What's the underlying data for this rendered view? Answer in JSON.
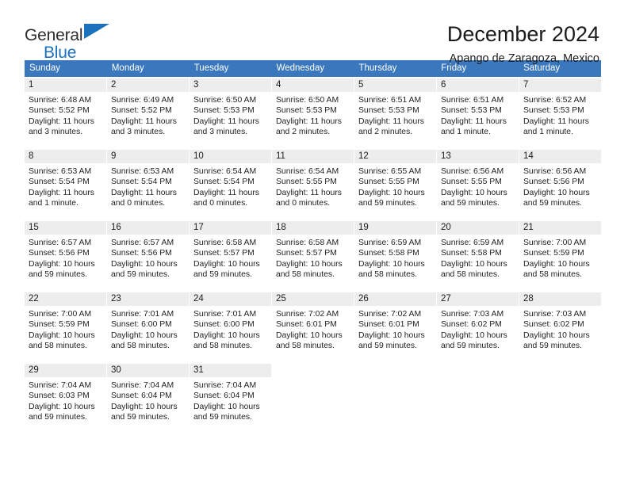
{
  "logo": {
    "line1": "General",
    "line2": "Blue"
  },
  "header": {
    "title": "December 2024",
    "subtitle": "Apango de Zaragoza, Mexico"
  },
  "colors": {
    "header_blue": "#3b77bc",
    "logo_blue": "#1a72bd",
    "daynum_bg": "#ededed",
    "text": "#232323"
  },
  "weekdays": [
    "Sunday",
    "Monday",
    "Tuesday",
    "Wednesday",
    "Thursday",
    "Friday",
    "Saturday"
  ],
  "weeks": [
    [
      {
        "day": "1",
        "sunrise": "Sunrise: 6:48 AM",
        "sunset": "Sunset: 5:52 PM",
        "daylight_1": "Daylight: 11 hours",
        "daylight_2": "and 3 minutes."
      },
      {
        "day": "2",
        "sunrise": "Sunrise: 6:49 AM",
        "sunset": "Sunset: 5:52 PM",
        "daylight_1": "Daylight: 11 hours",
        "daylight_2": "and 3 minutes."
      },
      {
        "day": "3",
        "sunrise": "Sunrise: 6:50 AM",
        "sunset": "Sunset: 5:53 PM",
        "daylight_1": "Daylight: 11 hours",
        "daylight_2": "and 3 minutes."
      },
      {
        "day": "4",
        "sunrise": "Sunrise: 6:50 AM",
        "sunset": "Sunset: 5:53 PM",
        "daylight_1": "Daylight: 11 hours",
        "daylight_2": "and 2 minutes."
      },
      {
        "day": "5",
        "sunrise": "Sunrise: 6:51 AM",
        "sunset": "Sunset: 5:53 PM",
        "daylight_1": "Daylight: 11 hours",
        "daylight_2": "and 2 minutes."
      },
      {
        "day": "6",
        "sunrise": "Sunrise: 6:51 AM",
        "sunset": "Sunset: 5:53 PM",
        "daylight_1": "Daylight: 11 hours",
        "daylight_2": "and 1 minute."
      },
      {
        "day": "7",
        "sunrise": "Sunrise: 6:52 AM",
        "sunset": "Sunset: 5:53 PM",
        "daylight_1": "Daylight: 11 hours",
        "daylight_2": "and 1 minute."
      }
    ],
    [
      {
        "day": "8",
        "sunrise": "Sunrise: 6:53 AM",
        "sunset": "Sunset: 5:54 PM",
        "daylight_1": "Daylight: 11 hours",
        "daylight_2": "and 1 minute."
      },
      {
        "day": "9",
        "sunrise": "Sunrise: 6:53 AM",
        "sunset": "Sunset: 5:54 PM",
        "daylight_1": "Daylight: 11 hours",
        "daylight_2": "and 0 minutes."
      },
      {
        "day": "10",
        "sunrise": "Sunrise: 6:54 AM",
        "sunset": "Sunset: 5:54 PM",
        "daylight_1": "Daylight: 11 hours",
        "daylight_2": "and 0 minutes."
      },
      {
        "day": "11",
        "sunrise": "Sunrise: 6:54 AM",
        "sunset": "Sunset: 5:55 PM",
        "daylight_1": "Daylight: 11 hours",
        "daylight_2": "and 0 minutes."
      },
      {
        "day": "12",
        "sunrise": "Sunrise: 6:55 AM",
        "sunset": "Sunset: 5:55 PM",
        "daylight_1": "Daylight: 10 hours",
        "daylight_2": "and 59 minutes."
      },
      {
        "day": "13",
        "sunrise": "Sunrise: 6:56 AM",
        "sunset": "Sunset: 5:55 PM",
        "daylight_1": "Daylight: 10 hours",
        "daylight_2": "and 59 minutes."
      },
      {
        "day": "14",
        "sunrise": "Sunrise: 6:56 AM",
        "sunset": "Sunset: 5:56 PM",
        "daylight_1": "Daylight: 10 hours",
        "daylight_2": "and 59 minutes."
      }
    ],
    [
      {
        "day": "15",
        "sunrise": "Sunrise: 6:57 AM",
        "sunset": "Sunset: 5:56 PM",
        "daylight_1": "Daylight: 10 hours",
        "daylight_2": "and 59 minutes."
      },
      {
        "day": "16",
        "sunrise": "Sunrise: 6:57 AM",
        "sunset": "Sunset: 5:56 PM",
        "daylight_1": "Daylight: 10 hours",
        "daylight_2": "and 59 minutes."
      },
      {
        "day": "17",
        "sunrise": "Sunrise: 6:58 AM",
        "sunset": "Sunset: 5:57 PM",
        "daylight_1": "Daylight: 10 hours",
        "daylight_2": "and 59 minutes."
      },
      {
        "day": "18",
        "sunrise": "Sunrise: 6:58 AM",
        "sunset": "Sunset: 5:57 PM",
        "daylight_1": "Daylight: 10 hours",
        "daylight_2": "and 58 minutes."
      },
      {
        "day": "19",
        "sunrise": "Sunrise: 6:59 AM",
        "sunset": "Sunset: 5:58 PM",
        "daylight_1": "Daylight: 10 hours",
        "daylight_2": "and 58 minutes."
      },
      {
        "day": "20",
        "sunrise": "Sunrise: 6:59 AM",
        "sunset": "Sunset: 5:58 PM",
        "daylight_1": "Daylight: 10 hours",
        "daylight_2": "and 58 minutes."
      },
      {
        "day": "21",
        "sunrise": "Sunrise: 7:00 AM",
        "sunset": "Sunset: 5:59 PM",
        "daylight_1": "Daylight: 10 hours",
        "daylight_2": "and 58 minutes."
      }
    ],
    [
      {
        "day": "22",
        "sunrise": "Sunrise: 7:00 AM",
        "sunset": "Sunset: 5:59 PM",
        "daylight_1": "Daylight: 10 hours",
        "daylight_2": "and 58 minutes."
      },
      {
        "day": "23",
        "sunrise": "Sunrise: 7:01 AM",
        "sunset": "Sunset: 6:00 PM",
        "daylight_1": "Daylight: 10 hours",
        "daylight_2": "and 58 minutes."
      },
      {
        "day": "24",
        "sunrise": "Sunrise: 7:01 AM",
        "sunset": "Sunset: 6:00 PM",
        "daylight_1": "Daylight: 10 hours",
        "daylight_2": "and 58 minutes."
      },
      {
        "day": "25",
        "sunrise": "Sunrise: 7:02 AM",
        "sunset": "Sunset: 6:01 PM",
        "daylight_1": "Daylight: 10 hours",
        "daylight_2": "and 58 minutes."
      },
      {
        "day": "26",
        "sunrise": "Sunrise: 7:02 AM",
        "sunset": "Sunset: 6:01 PM",
        "daylight_1": "Daylight: 10 hours",
        "daylight_2": "and 59 minutes."
      },
      {
        "day": "27",
        "sunrise": "Sunrise: 7:03 AM",
        "sunset": "Sunset: 6:02 PM",
        "daylight_1": "Daylight: 10 hours",
        "daylight_2": "and 59 minutes."
      },
      {
        "day": "28",
        "sunrise": "Sunrise: 7:03 AM",
        "sunset": "Sunset: 6:02 PM",
        "daylight_1": "Daylight: 10 hours",
        "daylight_2": "and 59 minutes."
      }
    ],
    [
      {
        "day": "29",
        "sunrise": "Sunrise: 7:04 AM",
        "sunset": "Sunset: 6:03 PM",
        "daylight_1": "Daylight: 10 hours",
        "daylight_2": "and 59 minutes."
      },
      {
        "day": "30",
        "sunrise": "Sunrise: 7:04 AM",
        "sunset": "Sunset: 6:04 PM",
        "daylight_1": "Daylight: 10 hours",
        "daylight_2": "and 59 minutes."
      },
      {
        "day": "31",
        "sunrise": "Sunrise: 7:04 AM",
        "sunset": "Sunset: 6:04 PM",
        "daylight_1": "Daylight: 10 hours",
        "daylight_2": "and 59 minutes."
      },
      {
        "day": "",
        "sunrise": "",
        "sunset": "",
        "daylight_1": "",
        "daylight_2": ""
      },
      {
        "day": "",
        "sunrise": "",
        "sunset": "",
        "daylight_1": "",
        "daylight_2": ""
      },
      {
        "day": "",
        "sunrise": "",
        "sunset": "",
        "daylight_1": "",
        "daylight_2": ""
      },
      {
        "day": "",
        "sunrise": "",
        "sunset": "",
        "daylight_1": "",
        "daylight_2": ""
      }
    ]
  ]
}
